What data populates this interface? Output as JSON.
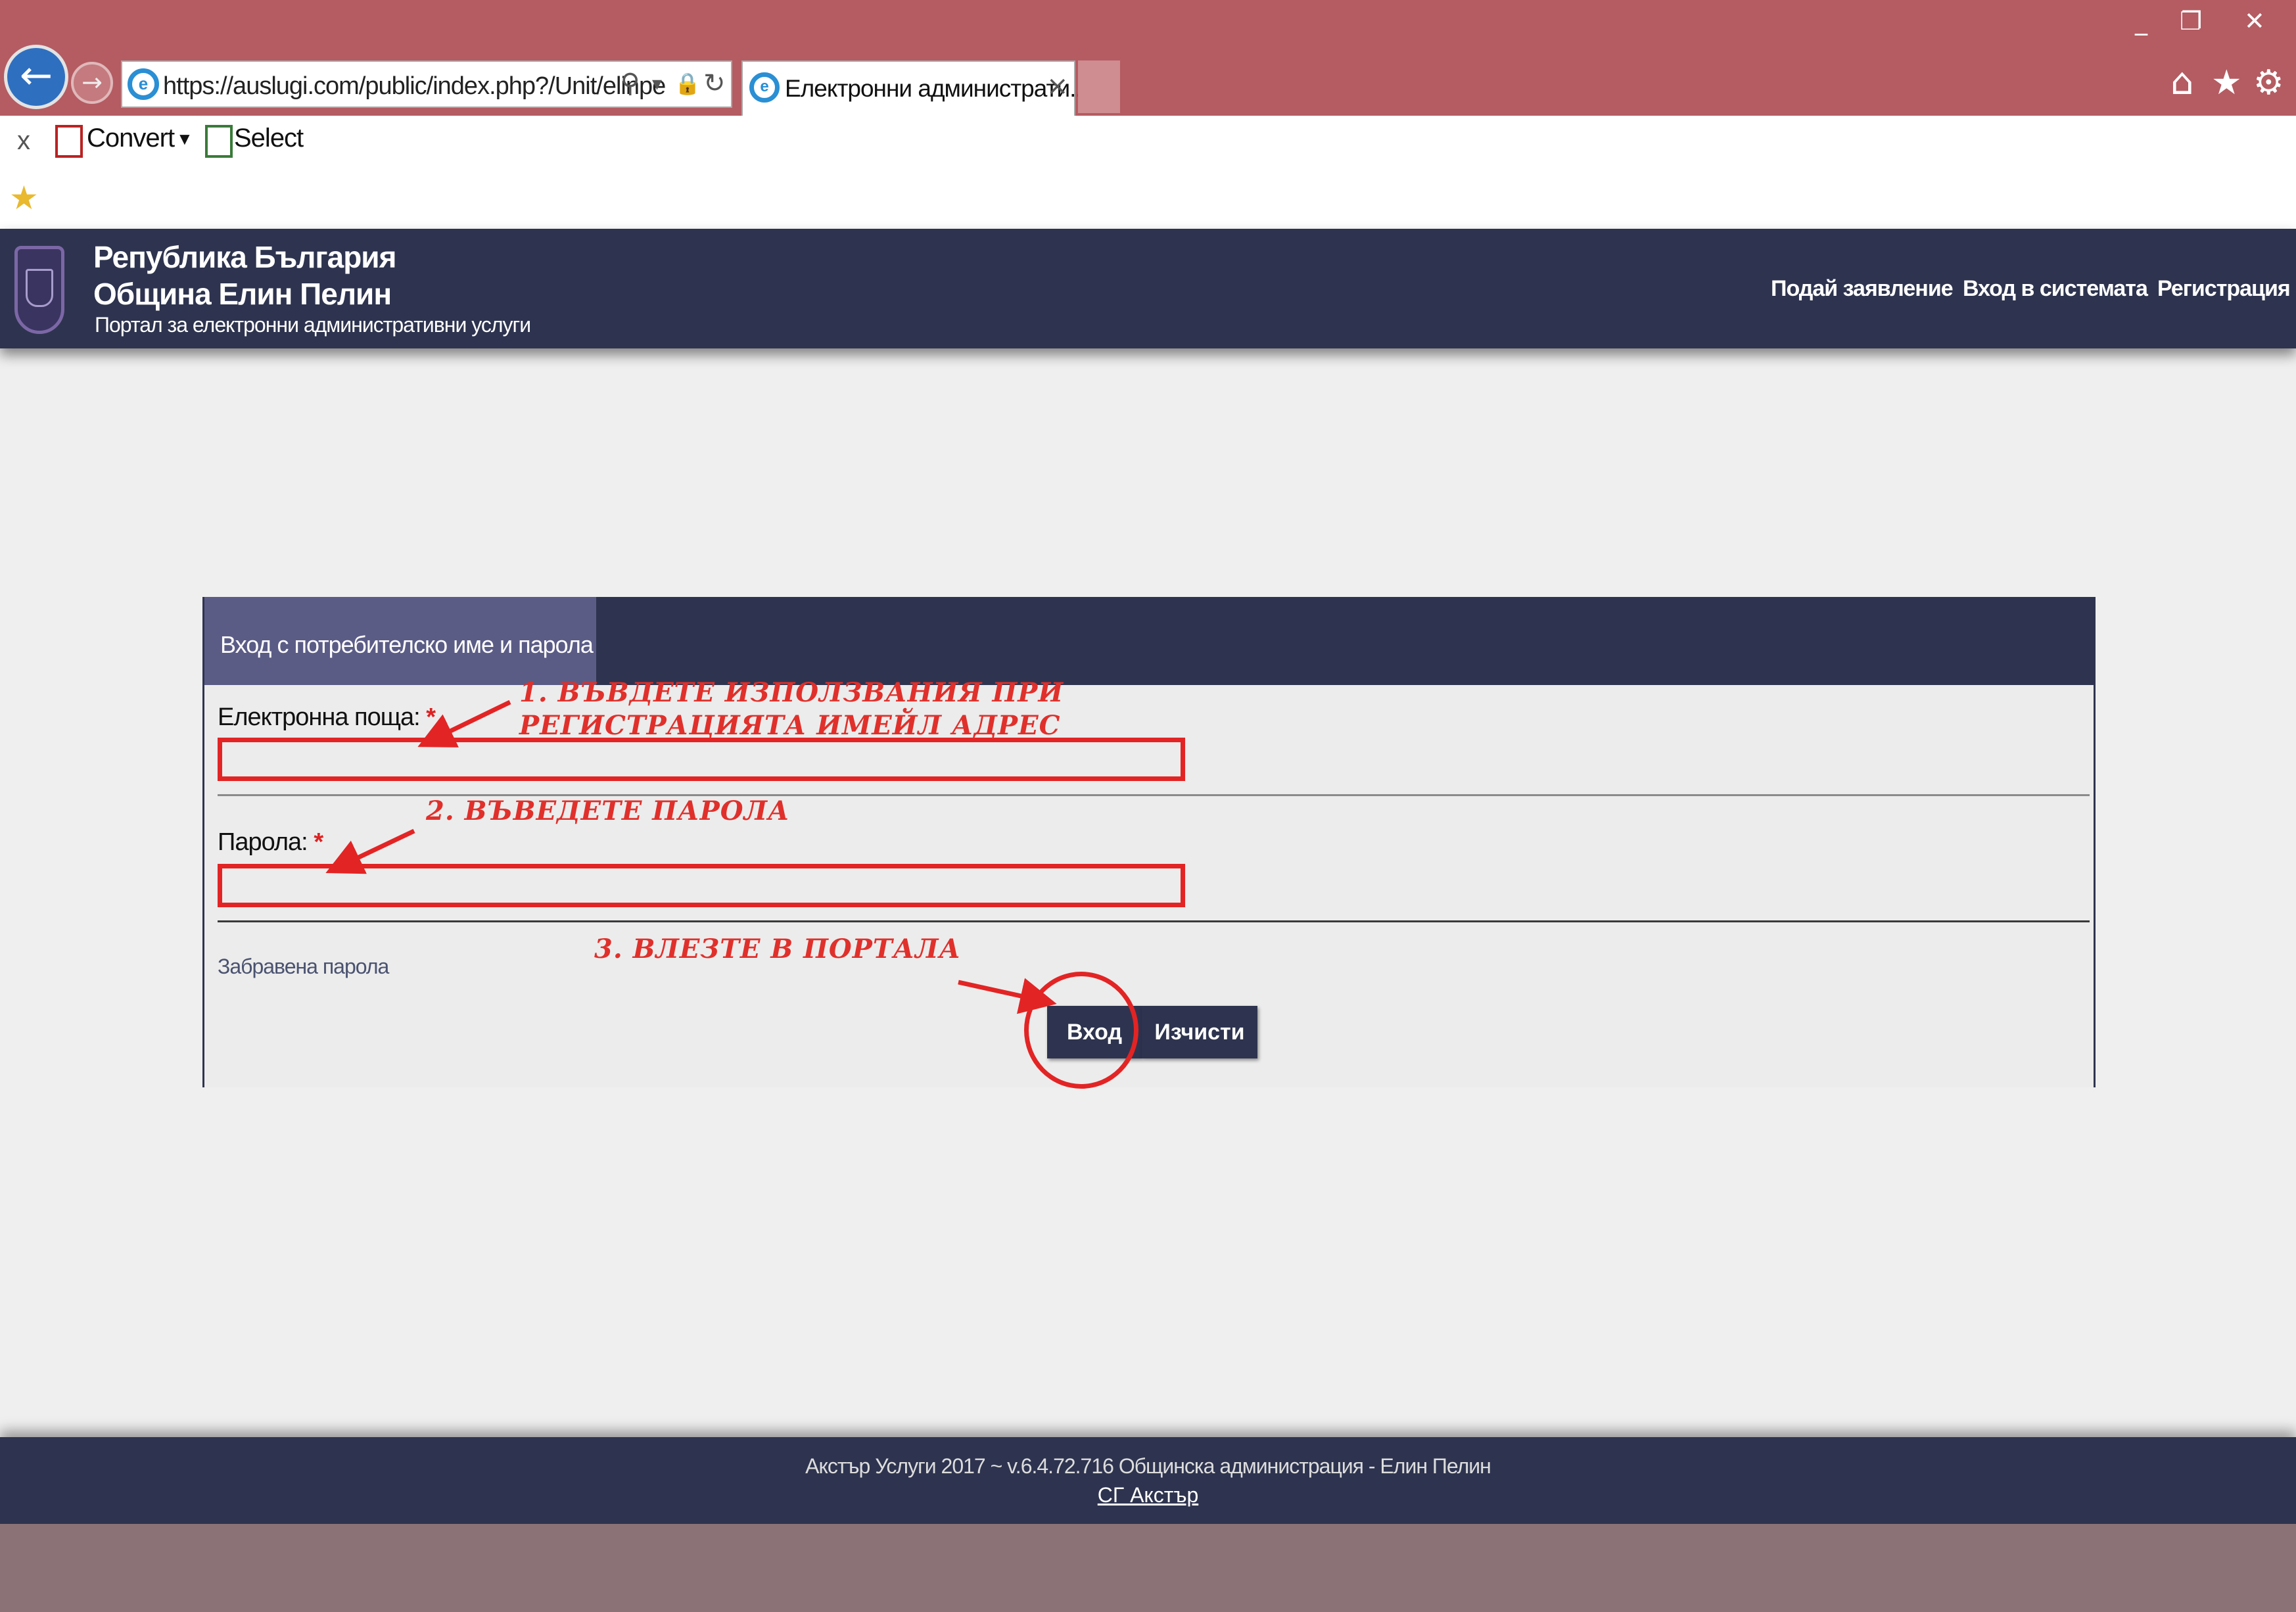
{
  "browser": {
    "url": "https://auslugi.com/public/index.php?/Unit/elinpe",
    "tab_title": "Електронни администрати...",
    "window_controls": {
      "minimize": "_",
      "restore": "❐",
      "close": "✕"
    },
    "tab_close": "×",
    "back_glyph": "←",
    "forward_glyph": "→",
    "address_icons": {
      "search": "⚲",
      "dropdown": "▾",
      "lock": "🔒",
      "refresh": "↻"
    },
    "right_icons": {
      "home": "⌂",
      "favorites": "★",
      "settings": "⚙"
    }
  },
  "commandbar": {
    "close_glyph": "x",
    "convert_label": "Convert",
    "convert_caret": "▼",
    "select_label": "Select",
    "favorites_glyph": "★"
  },
  "site": {
    "header": {
      "line1": "Република България",
      "line2": "Община Елин Пелин",
      "line3": "Портал за електронни административни услуги"
    },
    "nav": {
      "apply": "Подай заявление",
      "login": "Вход в системата",
      "register": "Регистрация"
    }
  },
  "login": {
    "title": "Вход с потребителско име и парола",
    "email_label": "Електронна поща:",
    "password_label": "Парола:",
    "required_mark": "*",
    "email_value": "",
    "password_value": "",
    "forgot_label": "Забравена парола",
    "submit_label": "Вход",
    "clear_label": "Изчисти"
  },
  "annotations": {
    "step1_line1": "1. ВЪВДЕТЕ ИЗПОЛЗВАНИЯ ПРИ",
    "step1_line2": "РЕГИСТРАЦИЯТА ИМЕЙЛ АДРЕС",
    "step2": "2. ВЪВЕДЕТЕ ПАРОЛА",
    "step3": "3. ВЛЕЗТЕ В ПОРТАЛА",
    "color": "#e32424"
  },
  "footer": {
    "text": "Акстър Услуги 2017 ~ v.6.4.72.716 Общинска администрация - Елин Пелин",
    "link": "СГ Акстър"
  },
  "colors": {
    "titlebar": "#b45c62",
    "site_navy": "#2e344f",
    "panel_tab": "#5b5c86"
  }
}
